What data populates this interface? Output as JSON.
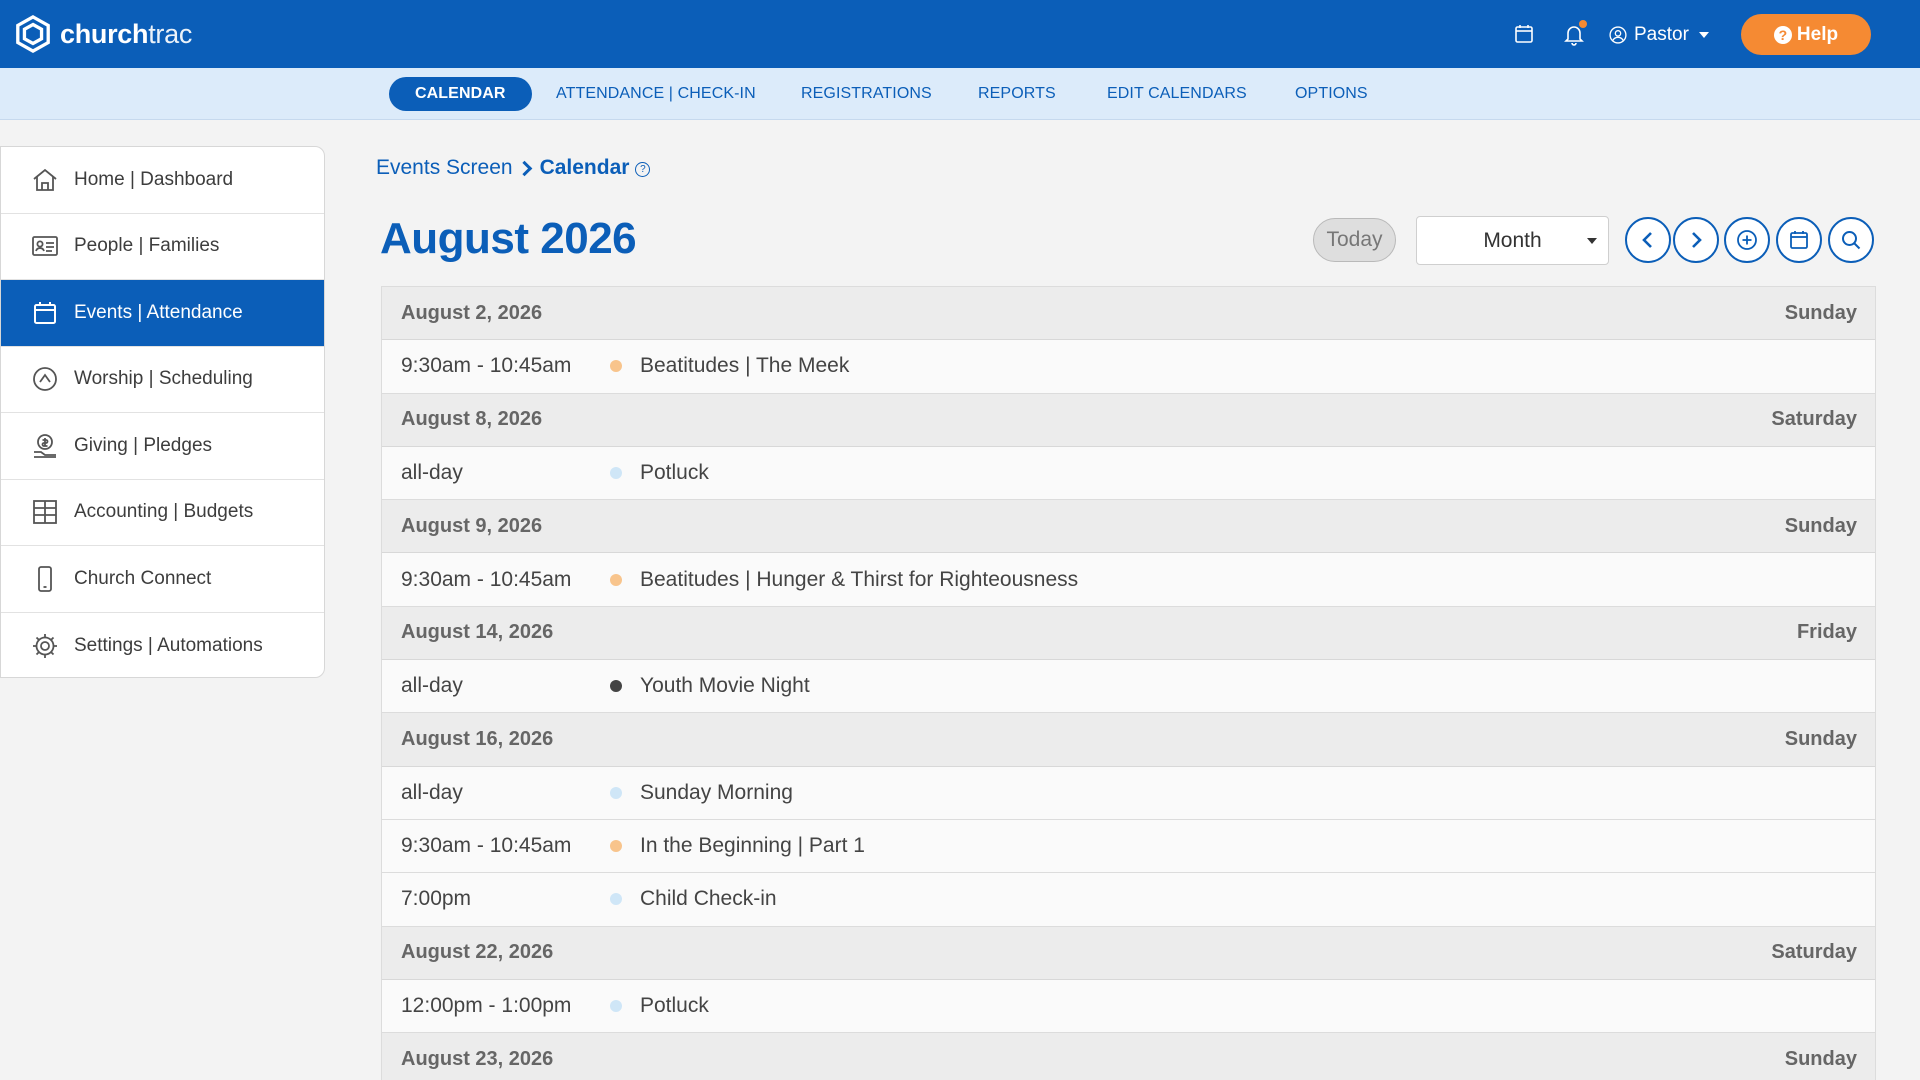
{
  "brand": {
    "name_bold": "church",
    "name_light": "trac"
  },
  "topbar": {
    "user_label": "Pastor",
    "help_label": "Help"
  },
  "tabs": [
    {
      "label": "CALENDAR",
      "active": true
    },
    {
      "label": "ATTENDANCE | CHECK-IN",
      "active": false
    },
    {
      "label": "REGISTRATIONS",
      "active": false
    },
    {
      "label": "REPORTS",
      "active": false
    },
    {
      "label": "EDIT CALENDARS",
      "active": false
    },
    {
      "label": "OPTIONS",
      "active": false
    }
  ],
  "sidebar": {
    "items": [
      {
        "label": "Home | Dashboard",
        "icon": "home-icon",
        "active": false
      },
      {
        "label": "People | Families",
        "icon": "id-card-icon",
        "active": false
      },
      {
        "label": "Events | Attendance",
        "icon": "calendar-icon",
        "active": true
      },
      {
        "label": "Worship | Scheduling",
        "icon": "worship-icon",
        "active": false
      },
      {
        "label": "Giving | Pledges",
        "icon": "giving-icon",
        "active": false
      },
      {
        "label": "Accounting | Budgets",
        "icon": "grid-icon",
        "active": false
      },
      {
        "label": "Church Connect",
        "icon": "phone-icon",
        "active": false
      },
      {
        "label": "Settings | Automations",
        "icon": "gear-icon",
        "active": false
      }
    ]
  },
  "breadcrumb": {
    "parent": "Events Screen",
    "current": "Calendar"
  },
  "calendar": {
    "title": "August 2026",
    "today_label": "Today",
    "view": "Month"
  },
  "colors": {
    "brand": "#0b5eb8",
    "accent": "#f58a33",
    "dot_orange": "#f8c48c",
    "dot_lightblue": "#cfe6f7",
    "dot_dark": "#444444"
  },
  "days": [
    {
      "date": "August 2, 2026",
      "weekday": "Sunday",
      "events": [
        {
          "time": "9:30am - 10:45am",
          "title": "Beatitudes | The Meek",
          "color": "#f8c48c"
        }
      ]
    },
    {
      "date": "August 8, 2026",
      "weekday": "Saturday",
      "events": [
        {
          "time": "all-day",
          "title": "Potluck",
          "color": "#cfe6f7"
        }
      ]
    },
    {
      "date": "August 9, 2026",
      "weekday": "Sunday",
      "events": [
        {
          "time": "9:30am - 10:45am",
          "title": "Beatitudes | Hunger & Thirst for Righteousness",
          "color": "#f8c48c"
        }
      ]
    },
    {
      "date": "August 14, 2026",
      "weekday": "Friday",
      "events": [
        {
          "time": "all-day",
          "title": "Youth Movie Night",
          "color": "#444444"
        }
      ]
    },
    {
      "date": "August 16, 2026",
      "weekday": "Sunday",
      "events": [
        {
          "time": "all-day",
          "title": "Sunday Morning",
          "color": "#cfe6f7"
        },
        {
          "time": "9:30am - 10:45am",
          "title": "In the Beginning | Part 1",
          "color": "#f8c48c"
        },
        {
          "time": "7:00pm",
          "title": "Child Check-in",
          "color": "#cfe6f7"
        }
      ]
    },
    {
      "date": "August 22, 2026",
      "weekday": "Saturday",
      "events": [
        {
          "time": "12:00pm - 1:00pm",
          "title": "Potluck",
          "color": "#cfe6f7"
        }
      ]
    },
    {
      "date": "August 23, 2026",
      "weekday": "Sunday",
      "events": []
    }
  ]
}
